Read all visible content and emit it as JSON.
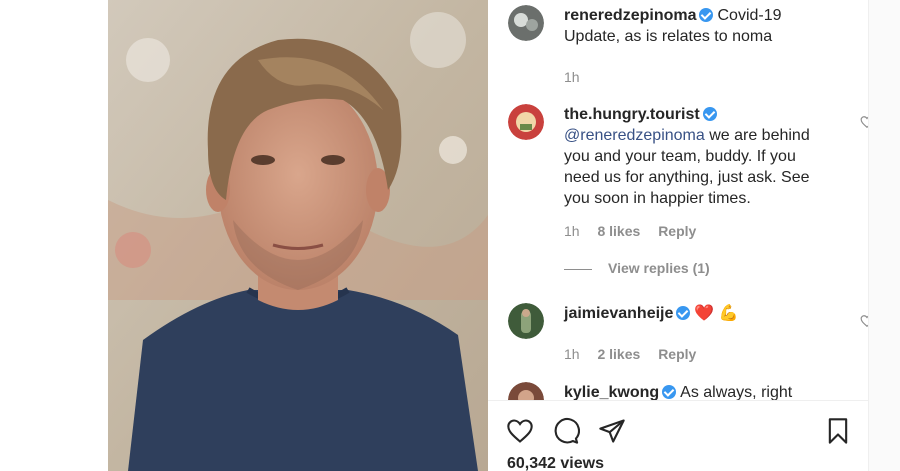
{
  "post": {
    "caption_user": "reneredzepinoma",
    "caption_text": "Covid-19 Update, as is relates to noma",
    "caption_time": "1h",
    "views": "60,342 views"
  },
  "comments": [
    {
      "user": "the.hungry.tourist",
      "mention": "@reneredzepinoma",
      "text": " we are behind you and your team, buddy. If you need us for anything, just ask. See you soon in happier times.",
      "time": "1h",
      "likes": "8 likes",
      "reply": "Reply",
      "view_replies": "View replies (1)"
    },
    {
      "user": "jaimievanheije",
      "text": "❤️ 💪",
      "time": "1h",
      "likes": "2 likes",
      "reply": "Reply"
    },
    {
      "user": "kylie_kwong",
      "text": "As always, right"
    }
  ],
  "icons": {
    "like": "heart-icon",
    "comment": "comment-icon",
    "share": "paper-plane-icon",
    "save": "bookmark-icon"
  },
  "colors": {
    "link": "#385185",
    "muted": "#8e8e8e",
    "verified": "#3897f0",
    "heart": "#ed4956"
  }
}
